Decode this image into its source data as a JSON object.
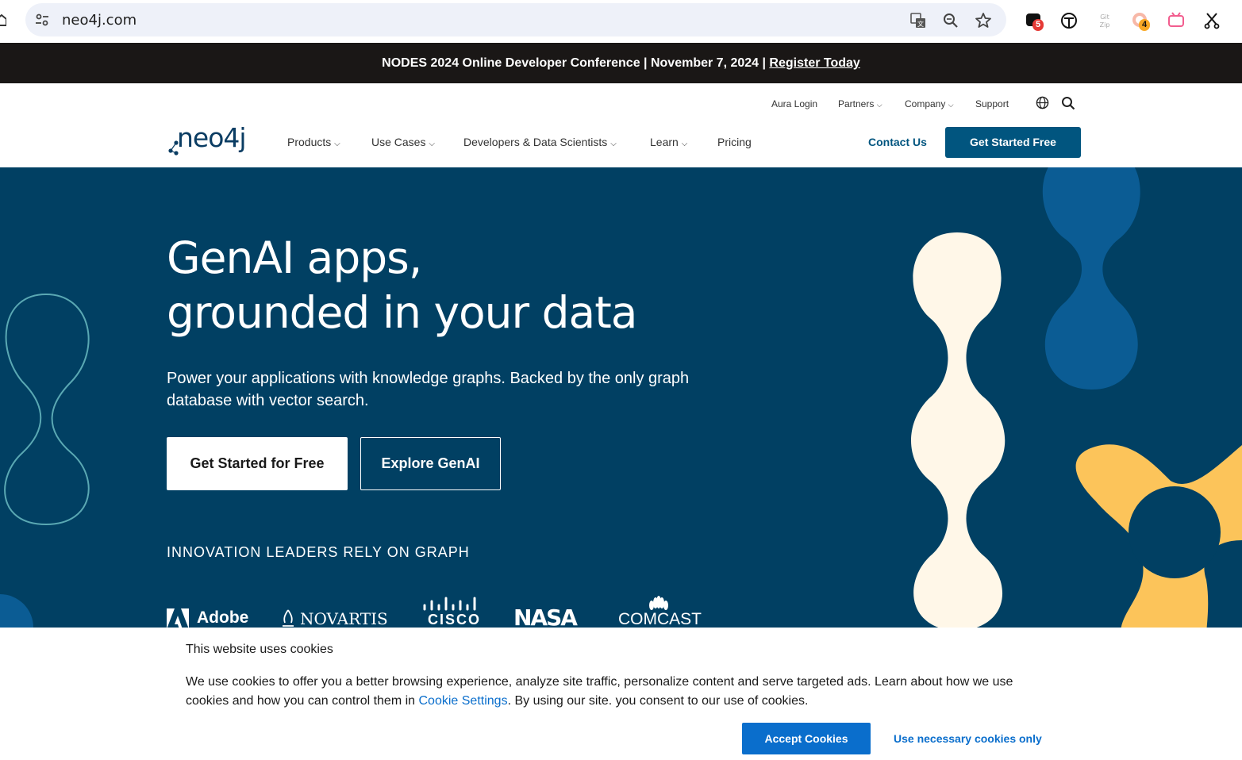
{
  "browser": {
    "url": "neo4j.com",
    "extensions": [
      {
        "name": "extension-1",
        "badge": "5",
        "badge_color": "#e53935"
      },
      {
        "name": "extension-2"
      },
      {
        "name": "gitzip-extension",
        "text": "Git Zip"
      },
      {
        "name": "extension-4",
        "badge": "4",
        "badge_color": "#f9a825"
      },
      {
        "name": "bilibili-extension"
      },
      {
        "name": "scissors-extension"
      }
    ]
  },
  "announcement": {
    "text": "NODES 2024 Online Developer Conference | November 7, 2024 | ",
    "link": "Register Today"
  },
  "header": {
    "utility": {
      "aura_login": "Aura Login",
      "partners": "Partners",
      "company": "Company",
      "support": "Support"
    },
    "logo": "neo4j",
    "nav": {
      "products": "Products",
      "use_cases": "Use Cases",
      "developers": "Developers & Data Scientists",
      "learn": "Learn",
      "pricing": "Pricing"
    },
    "contact": "Contact Us",
    "cta": "Get Started Free"
  },
  "hero": {
    "title_line1": "GenAI apps,",
    "title_line2": "grounded in your data",
    "subtitle": "Power your applications with knowledge graphs. Backed by the only graph database with vector search.",
    "primary_cta": "Get Started for Free",
    "secondary_cta": "Explore GenAI",
    "leaders_heading": "INNOVATION LEADERS RELY ON GRAPH",
    "logos": {
      "adobe": "Adobe",
      "novartis": "NOVARTIS",
      "cisco": "CISCO",
      "nasa": "NASA",
      "comcast": "COMCAST"
    }
  },
  "cookie": {
    "title": "This website uses cookies",
    "text_before": "We use cookies to offer you a better browsing experience, analyze site traffic, personalize content and serve targeted ads.  Learn about how we use cookies and how you can control them in ",
    "link": "Cookie Settings",
    "text_after": ". By using our site. you consent to our use of cookies.",
    "accept": "Accept Cookies",
    "necessary": "Use necessary cookies only"
  },
  "colors": {
    "hero_bg": "#014063",
    "brand_blue": "#01557f",
    "cookie_blue": "#0a6ecc",
    "cream": "#fff7e8",
    "yellow": "#fcc45a",
    "deco_blue": "#0b5c94",
    "outline_teal": "#5aa8b3"
  }
}
